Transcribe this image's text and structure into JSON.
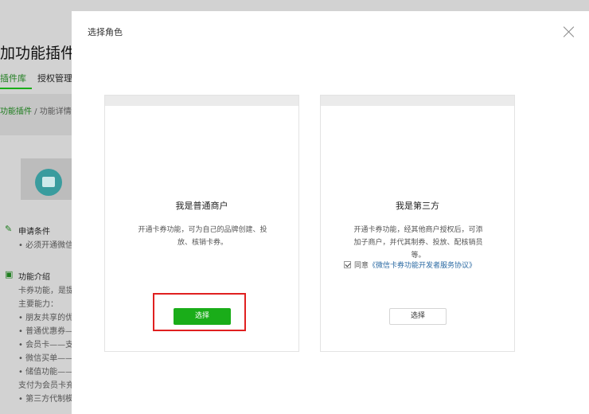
{
  "background": {
    "title": "加功能插件",
    "tabs": [
      "插件库",
      "授权管理"
    ],
    "breadcrumb": {
      "link": "功能插件",
      "separator": " / ",
      "current": "功能详情"
    },
    "apply_heading": "申请条件",
    "apply_item": "必须开通微信",
    "intro_heading": "功能介绍",
    "intro_lines": [
      "卡券功能，是提",
      "主要能力：",
      "朋友共享的优",
      "普通优惠券—",
      "会员卡——支",
      "微信买单——",
      "储值功能——",
      "支付为会员卡充",
      "第三方代制模"
    ]
  },
  "modal": {
    "title": "选择角色",
    "close_icon": "close-icon",
    "cards": [
      {
        "title": "我是普通商户",
        "description": "开通卡券功能，可为自己的品牌创建、投放、核销卡券。",
        "button": "选择"
      },
      {
        "title": "我是第三方",
        "description": "开通卡券功能，经其他商户授权后，可添加子商户，并代其制券、投放、配核销员等。",
        "agree_prefix": "同意",
        "agree_link": "《微信卡券功能开发者服务协议》",
        "agree_checked": true,
        "button": "选择"
      }
    ]
  },
  "colors": {
    "primary": "#1aad19",
    "highlight": "#e02020",
    "link": "#2b6aa3",
    "overlay": "#d2d2d2"
  }
}
